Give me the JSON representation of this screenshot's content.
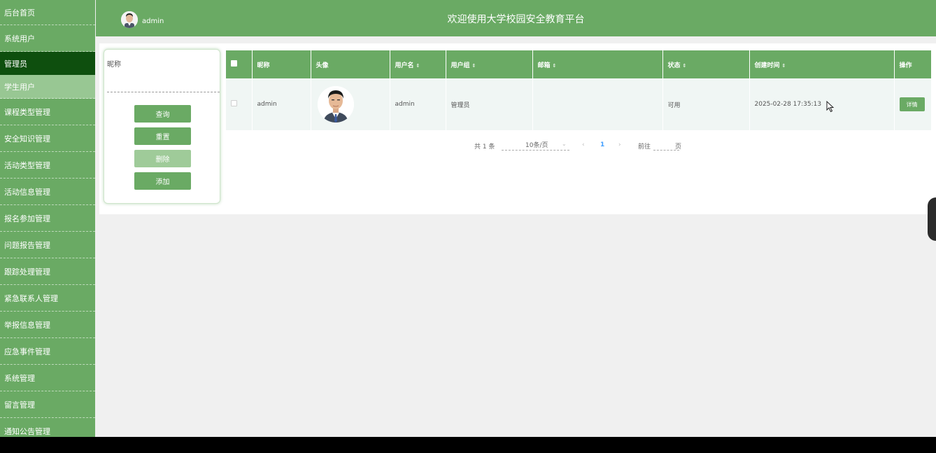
{
  "header": {
    "username": "admin",
    "title": "欢迎使用大学校园安全教育平台"
  },
  "sidebar": {
    "items": [
      {
        "label": "后台首页"
      },
      {
        "label": "系统用户"
      },
      {
        "label": "管理员"
      },
      {
        "label": "学生用户"
      },
      {
        "label": "课程类型管理"
      },
      {
        "label": "安全知识管理"
      },
      {
        "label": "活动类型管理"
      },
      {
        "label": "活动信息管理"
      },
      {
        "label": "报名参加管理"
      },
      {
        "label": "问题报告管理"
      },
      {
        "label": "跟踪处理管理"
      },
      {
        "label": "紧急联系人管理"
      },
      {
        "label": "举报信息管理"
      },
      {
        "label": "应急事件管理"
      },
      {
        "label": "系统管理"
      },
      {
        "label": "留言管理"
      },
      {
        "label": "通知公告管理"
      }
    ]
  },
  "search": {
    "label": "昵称",
    "value": "",
    "buttons": {
      "query": "查询",
      "reset": "重置",
      "delete": "删除",
      "add": "添加"
    }
  },
  "table": {
    "columns": [
      "昵称",
      "头像",
      "用户名",
      "用户组",
      "邮箱",
      "状态",
      "创建时间",
      "操作"
    ],
    "rows": [
      {
        "nickname": "admin",
        "username": "admin",
        "group": "管理员",
        "email": "",
        "status": "可用",
        "created": "2025-02-28 17:35:13",
        "action": "详情"
      }
    ]
  },
  "pagination": {
    "total": "共 1 条",
    "page_size": "10条/页",
    "current": "1",
    "goto_label": "前往",
    "goto_value": "",
    "page_unit": "页"
  },
  "colors": {
    "primary": "#6aaa64",
    "active": "#0e4f0e",
    "sub_active": "#98c793",
    "link": "#409eff"
  },
  "icons": {
    "sort": "sort-caret-icon",
    "prev": "chevron-left-icon",
    "next": "chevron-right-icon",
    "dropdown": "chevron-down-icon",
    "cursor": "mouse-cursor-icon"
  }
}
